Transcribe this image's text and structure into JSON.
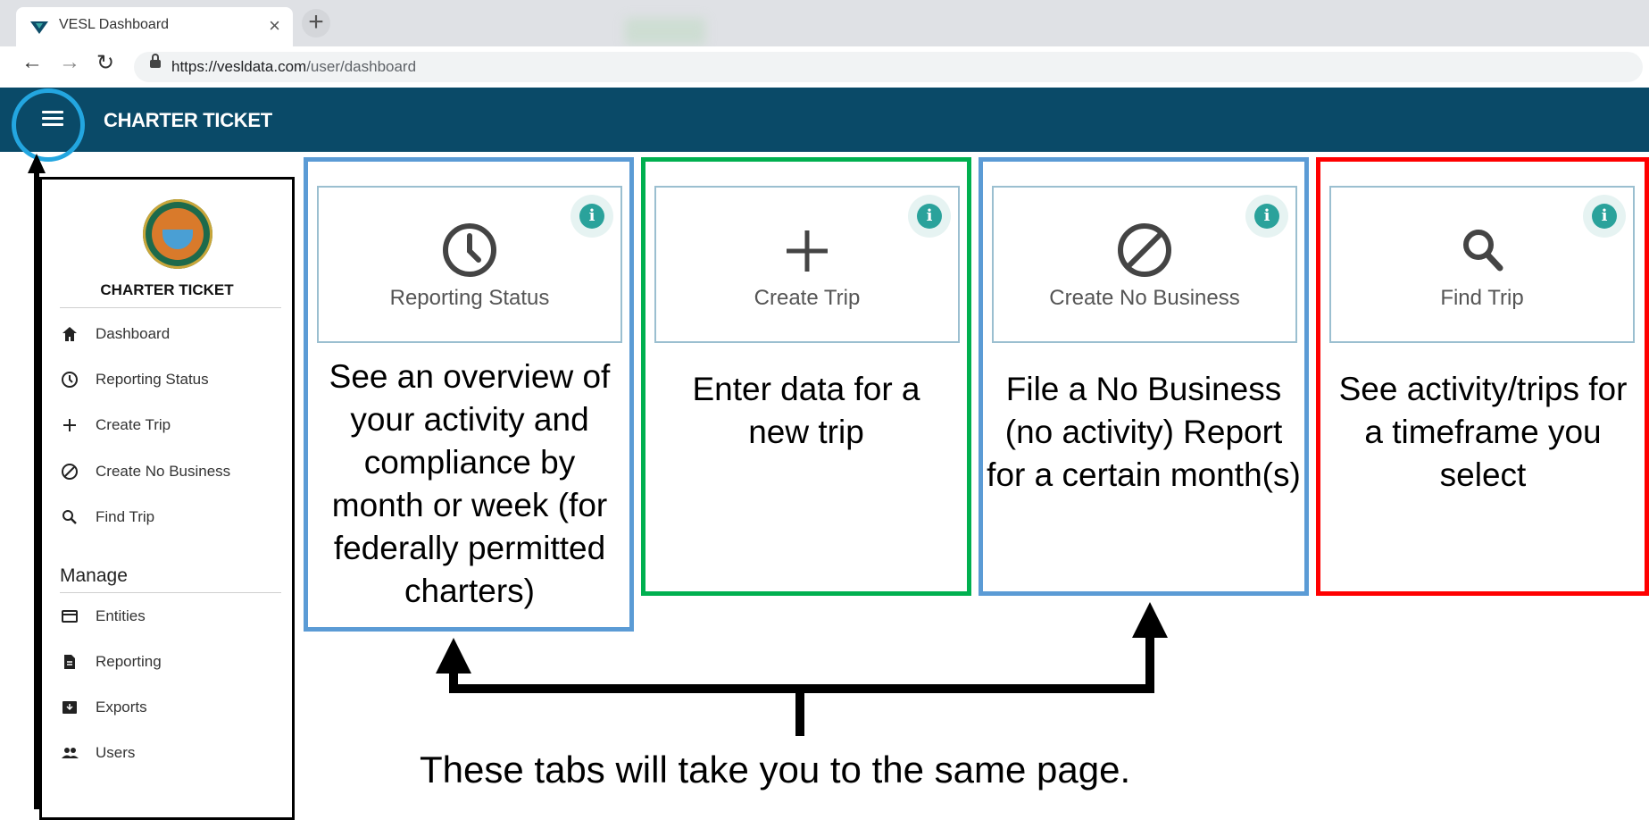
{
  "browser": {
    "tab_title": "VESL Dashboard",
    "url_host": "https://vesldata.com",
    "url_path": "/user/dashboard"
  },
  "header": {
    "title": "CHARTER TICKET"
  },
  "sidebar": {
    "title": "CHARTER TICKET",
    "items": [
      {
        "label": "Dashboard",
        "icon": "home-icon"
      },
      {
        "label": "Reporting Status",
        "icon": "clock-icon"
      },
      {
        "label": "Create Trip",
        "icon": "plus-icon"
      },
      {
        "label": "Create No Business",
        "icon": "block-icon"
      },
      {
        "label": "Find Trip",
        "icon": "search-icon"
      }
    ],
    "manage_heading": "Manage",
    "manage_items": [
      {
        "label": "Entities",
        "icon": "card-icon"
      },
      {
        "label": "Reporting",
        "icon": "document-icon"
      },
      {
        "label": "Exports",
        "icon": "archive-icon"
      },
      {
        "label": "Users",
        "icon": "users-icon"
      }
    ]
  },
  "cards": [
    {
      "label": "Reporting Status",
      "icon": "clock-icon",
      "info": "i",
      "frame_color": "#5b9bd5",
      "description": "See an overview of your activity and compliance by month or week (for federally permitted charters)"
    },
    {
      "label": "Create Trip",
      "icon": "plus-icon",
      "info": "i",
      "frame_color": "#00b050",
      "description": "Enter data for a new trip"
    },
    {
      "label": "Create No Business",
      "icon": "block-icon",
      "info": "i",
      "frame_color": "#5b9bd5",
      "description": "File a No Business (no activity) Report for a certain month(s)"
    },
    {
      "label": "Find Trip",
      "icon": "search-icon",
      "info": "i",
      "frame_color": "#ff0000",
      "description": "See activity/trips for a timeframe you select"
    }
  ],
  "annotation": {
    "note": "These tabs will take you to the same page."
  },
  "colors": {
    "appbar": "#0a4a68",
    "menu_highlight": "#23a6e0",
    "info_button": "#2aa29b"
  }
}
